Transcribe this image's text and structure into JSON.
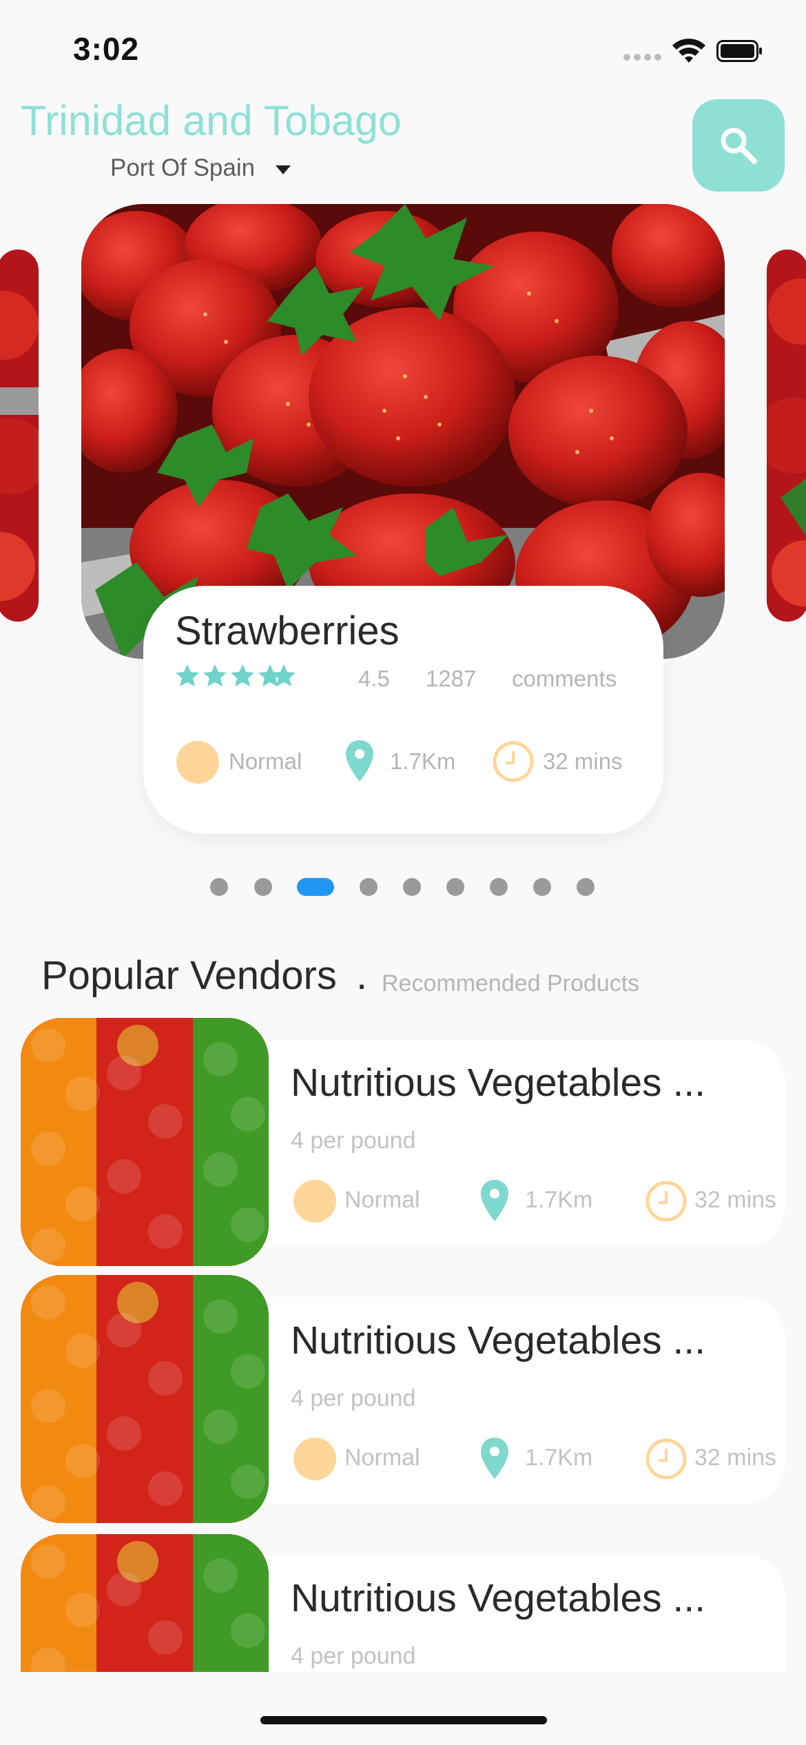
{
  "status_bar": {
    "time": "3:02"
  },
  "header": {
    "country": "Trinidad and Tobago",
    "city": "Port Of Spain"
  },
  "featured": {
    "title": "Strawberries",
    "stars": 5,
    "rating": "4.5",
    "review_count": "1287",
    "review_label": "comments",
    "level": "Normal",
    "distance": "1.7Km",
    "time": "32 mins"
  },
  "carousel": {
    "total": 9,
    "active_index": 2
  },
  "section": {
    "title": "Popular Vendors",
    "separator": ".",
    "subtitle": "Recommended Products"
  },
  "vendors": [
    {
      "name": "Nutritious Vegetables ...",
      "price": "4 per pound",
      "level": "Normal",
      "distance": "1.7Km",
      "time": "32 mins"
    },
    {
      "name": "Nutritious Vegetables ...",
      "price": "4 per pound",
      "level": "Normal",
      "distance": "1.7Km",
      "time": "32 mins"
    },
    {
      "name": "Nutritious Vegetables ...",
      "price": "4 per pound"
    }
  ],
  "colors": {
    "accent": "#8ee0d5",
    "active_dot": "#2196f3",
    "level_circle": "#ffd699",
    "clock": "#ffd699"
  },
  "icons": [
    "search-icon",
    "caret-down-icon",
    "star-icon",
    "location-pin-icon",
    "clock-icon",
    "wifi-icon",
    "battery-icon"
  ]
}
